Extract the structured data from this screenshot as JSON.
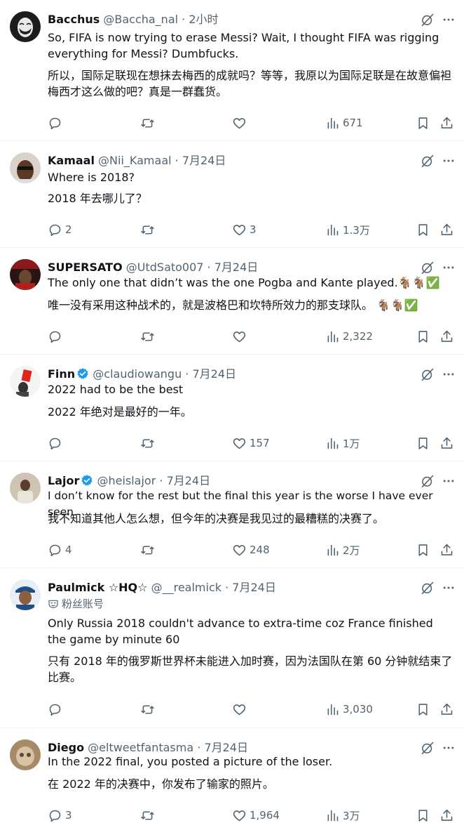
{
  "tweets": [
    {
      "name": "Bacchus",
      "handle": "@Baccha_nal",
      "time": "2小时",
      "verified": false,
      "badge": "",
      "text": "So, FIFA is now trying to erase Messi? Wait, I thought FIFA was rigging everything for Messi? Dumbfucks.",
      "translation": "所以，国际足联现在想抹去梅西的成就吗？等等，我原以为国际足联是在故意偏袒梅西才这么做的吧？真是一群蠢货。",
      "replies": "",
      "retweets": "",
      "likes": "",
      "views": "671",
      "avatar_color": "#1a1a1a"
    },
    {
      "name": "Kamaal",
      "handle": "@Nii_Kamaal",
      "time": "7月24日",
      "verified": false,
      "badge": "",
      "text": "Where is 2018?",
      "translation": "2018 年去哪儿了？",
      "replies": "2",
      "retweets": "",
      "likes": "3",
      "views": "1.3万",
      "avatar_color": "#6b4a32"
    },
    {
      "name": "SUPERSATO",
      "handle": "@UtdSato007",
      "time": "7月24日",
      "verified": false,
      "badge": "",
      "text": "The only one that didn’t was the one Pogba and Kante played.🐐🐐✅",
      "translation": "唯一没有采用这种战术的，就是波格巴和坎特所效力的那支球队。 🐐🐐✅",
      "replies": "",
      "retweets": "",
      "likes": "",
      "views": "2,322",
      "avatar_color": "#3a1c1c"
    },
    {
      "name": "Finn",
      "handle": "@claudiowangu",
      "time": "7月24日",
      "verified": true,
      "badge": "",
      "text": "2022 had to be the best",
      "translation": "2022 年绝对是最好的一年。",
      "replies": "",
      "retweets": "",
      "likes": "157",
      "views": "1万",
      "avatar_color": "#f2f2f2"
    },
    {
      "name": "Lajor",
      "handle": "@heislajor",
      "time": "7月24日",
      "verified": true,
      "badge": "",
      "text": "I don’t know for the rest but the final this year is the worse I have ever seen.",
      "translation": "我不知道其他人怎么想，但今年的决赛是我见过的最糟糕的决赛了。",
      "replies": "4",
      "retweets": "",
      "likes": "248",
      "views": "2万",
      "avatar_color": "#b9a58c"
    },
    {
      "name": "Paulmick ☆HQ☆",
      "handle": "@__realmick",
      "time": "7月24日",
      "verified": false,
      "badge": "粉丝账号",
      "text": "Only Russia 2018 couldn't advance to extra-time coz France finished the game by minute 60",
      "translation": "只有 2018 年的俄罗斯世界杯未能进入加时赛，因为法国队在第 60 分钟就结束了比赛。",
      "replies": "",
      "retweets": "",
      "likes": "",
      "views": "3,030",
      "avatar_color": "#2b5d8f"
    },
    {
      "name": "Diego",
      "handle": "@eltweetfantasma",
      "time": "7月24日",
      "verified": false,
      "badge": "",
      "text": "In the 2022 final, you posted a picture of the loser.",
      "translation": "在 2022 年的决赛中，你发布了输家的照片。",
      "replies": "3",
      "retweets": "",
      "likes": "1,964",
      "views": "3万",
      "avatar_color": "#8a6a4a"
    }
  ]
}
